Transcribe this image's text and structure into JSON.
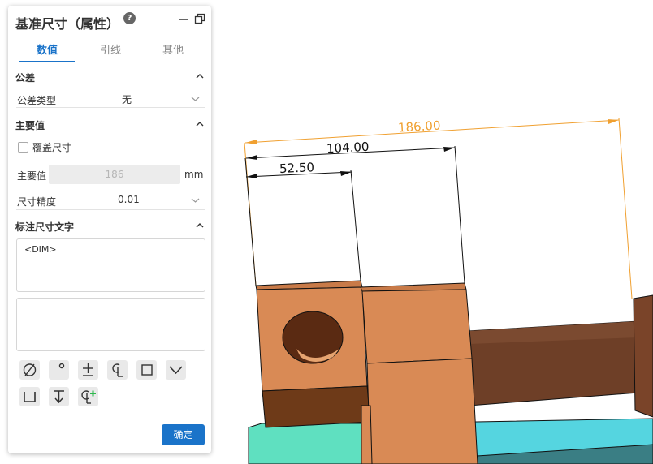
{
  "panel": {
    "title": "基准尺寸（属性）",
    "help_label": "?",
    "tabs": [
      "数值",
      "引线",
      "其他"
    ],
    "active_tab": 0
  },
  "tolerance": {
    "section_title": "公差",
    "type_label": "公差类型",
    "type_value": "无"
  },
  "primary": {
    "section_title": "主要值",
    "override_label": "覆盖尺寸",
    "override_checked": false,
    "value_label": "主要值",
    "value": "186",
    "unit": "mm",
    "precision_label": "尺寸精度",
    "precision_value": "0.01"
  },
  "dim_text": {
    "section_title": "标注尺寸文字",
    "content": "<DIM>"
  },
  "symbols": [
    "diameter-icon",
    "degree-icon",
    "plus-minus-icon",
    "centerline-icon",
    "square-icon",
    "countersink-icon",
    "counterbore-icon",
    "depth-icon",
    "add-symbol-icon"
  ],
  "confirm_label": "确定",
  "viewport": {
    "dims": [
      "186.00",
      "104.00",
      "52.50"
    ],
    "colors": {
      "overall_dim": "#f0a030",
      "dim": "#111111",
      "part_orange": "#d98a55",
      "part_dark": "#6e3a18",
      "shaft": "#6a3d25",
      "plate_teal": "#5fe0c0",
      "plate_cyan": "#55d5e0"
    }
  }
}
